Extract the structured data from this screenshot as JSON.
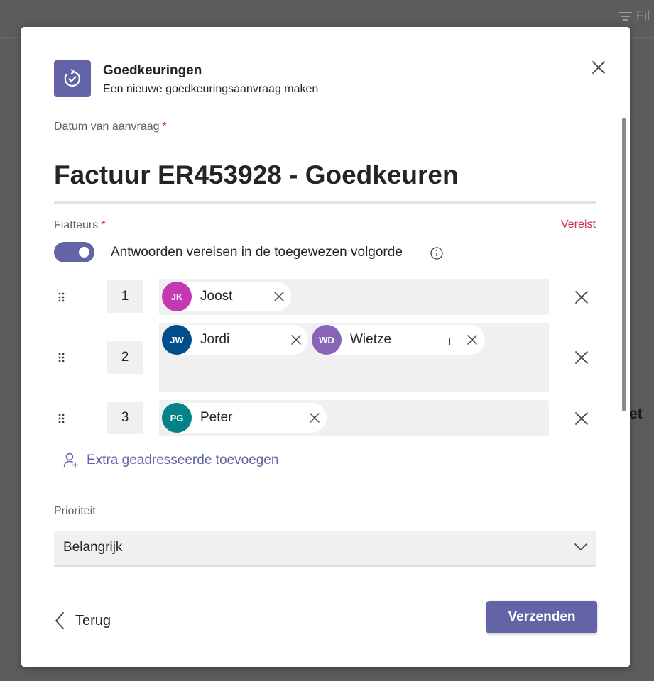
{
  "background": {
    "filter_label": "Fil",
    "peek_text": "et"
  },
  "header": {
    "title": "Goedkeuringen",
    "subtitle": "Een nieuwe goedkeuringsaanvraag maken",
    "app_icon": "approvals-icon"
  },
  "form": {
    "date_label": "Datum van aanvraag",
    "required_mark": "*",
    "title_value": "Factuur ER453928 - Goedkeuren",
    "approvers_label": "Fiatteurs",
    "required_text": "Vereist",
    "toggle_label": "Antwoorden vereisen in de toegewezen volgorde",
    "toggle_on": true,
    "approver_rows": [
      {
        "number": "1",
        "people": [
          {
            "initials": "JK",
            "name": "Joost",
            "color": "#c239b3"
          }
        ]
      },
      {
        "number": "2",
        "people": [
          {
            "initials": "JW",
            "name": "Jordi",
            "color": "#004e8c"
          },
          {
            "initials": "WD",
            "name": "Wietze",
            "color": "#8764b8"
          }
        ]
      },
      {
        "number": "3",
        "people": [
          {
            "initials": "PG",
            "name": "Peter",
            "color": "#038387"
          }
        ]
      }
    ],
    "add_recipient_label": "Extra geadresseerde toevoegen",
    "priority_label": "Prioriteit",
    "priority_value": "Belangrijk"
  },
  "footer": {
    "back_label": "Terug",
    "send_label": "Verzenden"
  },
  "colors": {
    "accent": "#6264a7",
    "required": "#c4314b",
    "field_bg": "#f0f0f0"
  }
}
